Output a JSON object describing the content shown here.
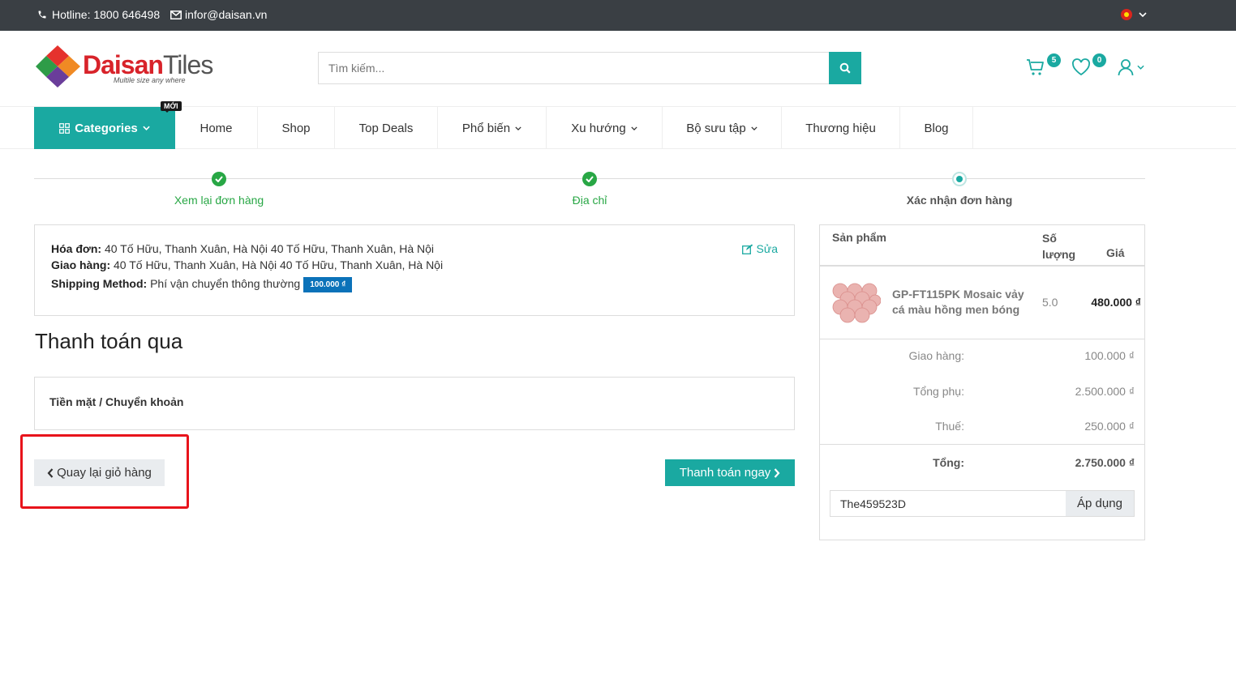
{
  "topbar": {
    "hotline": "Hotline: 1800 646498",
    "email": "infor@daisan.vn"
  },
  "header": {
    "logo_brand_red": "Daisan",
    "logo_brand_gray": "Tiles",
    "logo_slogan": "Multile size any where",
    "search_placeholder": "Tìm kiếm...",
    "cart_count": "5",
    "wishlist_count": "0"
  },
  "nav": {
    "categories": "Categories",
    "new_tag": "MỚI",
    "items": [
      "Home",
      "Shop",
      "Top Deals",
      "Phổ biến",
      "Xu hướng",
      "Bộ sưu tập",
      "Thương hiệu",
      "Blog"
    ]
  },
  "steps": [
    "Xem lại đơn hàng",
    "Địa chỉ",
    "Xác nhận đơn hàng"
  ],
  "address": {
    "invoice_label": "Hóa đơn:",
    "invoice_value": " 40 Tố Hữu, Thanh Xuân, Hà Nội 40 Tố Hữu, Thanh Xuân, Hà Nội",
    "shipping_label": "Giao hàng:",
    "shipping_value": " 40 Tố Hữu, Thanh Xuân, Hà Nội 40 Tố Hữu, Thanh Xuân, Hà Nội",
    "method_label": "Shipping Method:",
    "method_value": " Phí vận chuyển thông thường",
    "method_price": "100.000 ₫",
    "edit": "Sửa"
  },
  "payment": {
    "title": "Thanh toán qua",
    "option": "Tiền mặt / Chuyển khoản"
  },
  "actions": {
    "back": "Quay lại giỏ hàng",
    "pay_now": "Thanh toán ngay"
  },
  "summary": {
    "col_product": "Sản phẩm",
    "col_qty_1": "Số",
    "col_qty_2": "lượng",
    "col_price": "Giá",
    "product_name": "GP-FT115PK Mosaic vảy cá màu hồng men bóng",
    "product_qty": "5.0",
    "product_price": "480.000 ₫",
    "shipping_label": "Giao hàng:",
    "shipping_value": "100.000 ₫",
    "subtotal_label": "Tổng phụ:",
    "subtotal_value": "2.500.000 ₫",
    "tax_label": "Thuế:",
    "tax_value": "250.000 ₫",
    "total_label": "Tổng:",
    "total_value": "2.750.000 ₫",
    "coupon_value": "The459523D",
    "apply": "Áp dụng"
  },
  "colors": {
    "accent": "#1aa9a1",
    "topbar": "#3a3f44",
    "step_done": "#28a745",
    "price_tag": "#0b72b9",
    "highlight": "#e8131b"
  }
}
